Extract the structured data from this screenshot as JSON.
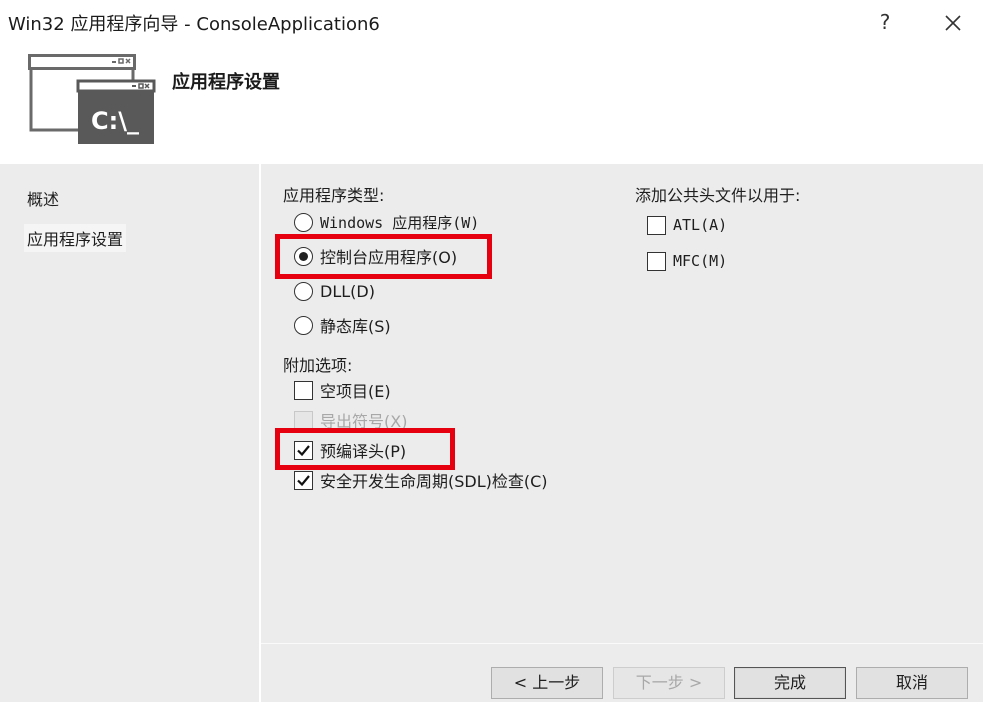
{
  "window": {
    "title": "Win32 应用程序向导 - ConsoleApplication6",
    "help_label": "?",
    "close_icon": "close-icon"
  },
  "header": {
    "title": "应用程序设置",
    "icon": "console-window-icon",
    "icon_text": "C:\\_"
  },
  "nav": {
    "items": [
      {
        "label": "概述",
        "selected": false
      },
      {
        "label": "应用程序设置",
        "selected": true
      }
    ]
  },
  "app_type": {
    "heading": "应用程序类型:",
    "options": [
      {
        "label": "Windows 应用程序(W)",
        "checked": false
      },
      {
        "label": "控制台应用程序(O)",
        "checked": true
      },
      {
        "label": "DLL(D)",
        "checked": false
      },
      {
        "label": "静态库(S)",
        "checked": false
      }
    ]
  },
  "additional": {
    "heading": "附加选项:",
    "options": [
      {
        "label": "空项目(E)",
        "checked": false,
        "enabled": true
      },
      {
        "label": "导出符号(X)",
        "checked": false,
        "enabled": false
      },
      {
        "label": "预编译头(P)",
        "checked": true,
        "enabled": true
      },
      {
        "label": "安全开发生命周期(SDL)检查(C)",
        "checked": true,
        "enabled": true
      }
    ]
  },
  "common_headers": {
    "heading": "添加公共头文件以用于:",
    "options": [
      {
        "label": "ATL(A)",
        "checked": false
      },
      {
        "label": "MFC(M)",
        "checked": false
      }
    ]
  },
  "buttons": {
    "prev": "< 上一步",
    "next": "下一步 >",
    "finish": "完成",
    "cancel": "取消"
  },
  "colors": {
    "highlight": "#e6000f",
    "panel": "#ececec",
    "icon_dark": "#595959"
  }
}
